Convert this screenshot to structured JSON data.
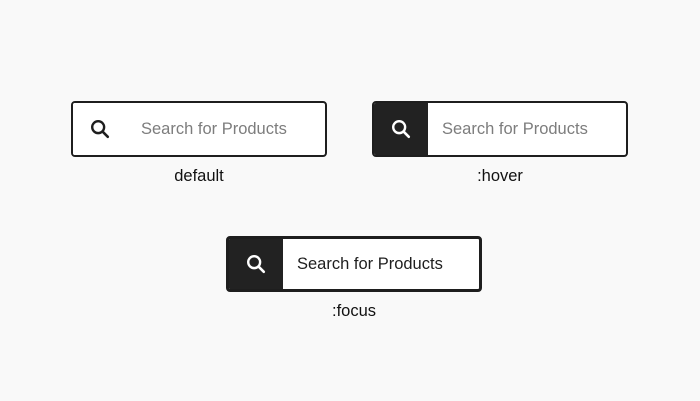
{
  "variants": {
    "default": {
      "placeholder": "Search for Products",
      "caption": "default",
      "icon": "search-icon"
    },
    "hover": {
      "placeholder": "Search for Products",
      "caption": ":hover",
      "icon": "search-icon"
    },
    "focus": {
      "value": "Search for Products",
      "caption": ":focus",
      "icon": "search-icon"
    }
  },
  "colors": {
    "background": "#f9f9f9",
    "border": "#1e1e1e",
    "icon_active_bg": "#222222",
    "placeholder": "#7d7d7d",
    "text": "#1e1e1e"
  }
}
